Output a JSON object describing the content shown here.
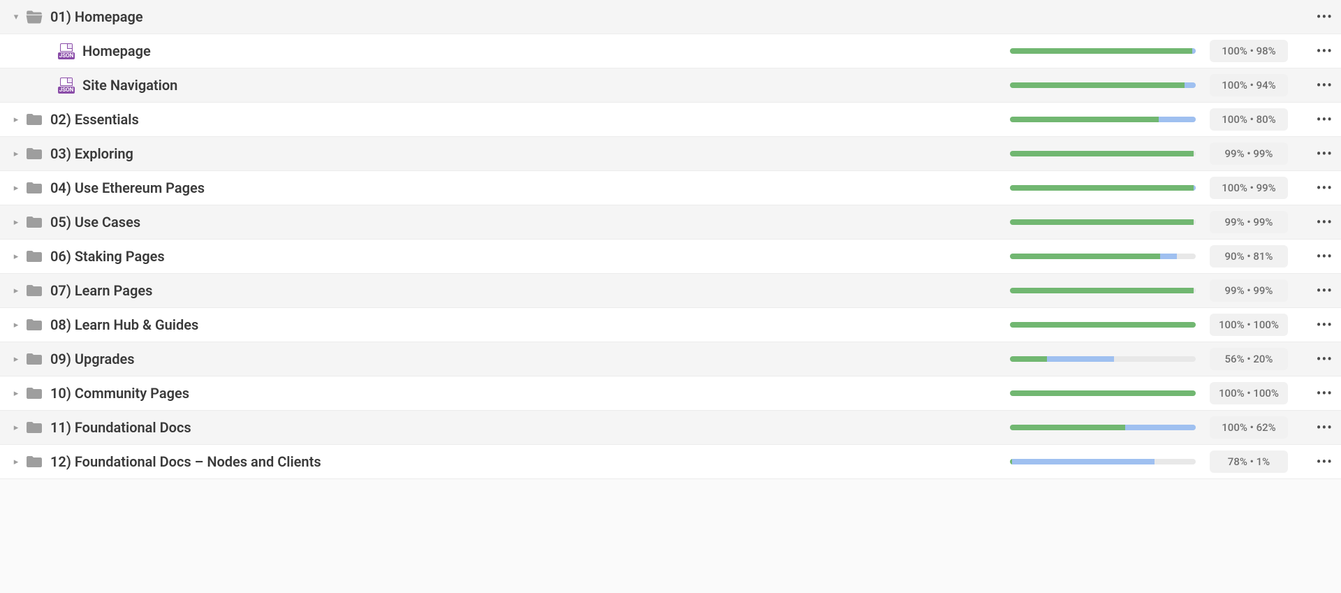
{
  "jsonLabel": "JSON",
  "rows": [
    {
      "level": 0,
      "type": "folder",
      "expanded": true,
      "name": "01) Homepage",
      "hasStats": false,
      "green": 0,
      "blue": 0,
      "pct1": "",
      "pct2": ""
    },
    {
      "level": 1,
      "type": "file",
      "expanded": false,
      "name": "Homepage",
      "hasStats": true,
      "green": 98,
      "blue": 2,
      "pct1": "100%",
      "pct2": "98%"
    },
    {
      "level": 1,
      "type": "file",
      "expanded": false,
      "name": "Site Navigation",
      "hasStats": true,
      "green": 94,
      "blue": 6,
      "pct1": "100%",
      "pct2": "94%"
    },
    {
      "level": 0,
      "type": "folder",
      "expanded": false,
      "name": "02) Essentials",
      "hasStats": true,
      "green": 80,
      "blue": 20,
      "pct1": "100%",
      "pct2": "80%"
    },
    {
      "level": 0,
      "type": "folder",
      "expanded": false,
      "name": "03) Exploring",
      "hasStats": true,
      "green": 99,
      "blue": 0,
      "pct1": "99%",
      "pct2": "99%"
    },
    {
      "level": 0,
      "type": "folder",
      "expanded": false,
      "name": "04) Use Ethereum Pages",
      "hasStats": true,
      "green": 99,
      "blue": 1,
      "pct1": "100%",
      "pct2": "99%"
    },
    {
      "level": 0,
      "type": "folder",
      "expanded": false,
      "name": "05) Use Cases",
      "hasStats": true,
      "green": 99,
      "blue": 0,
      "pct1": "99%",
      "pct2": "99%"
    },
    {
      "level": 0,
      "type": "folder",
      "expanded": false,
      "name": "06) Staking Pages",
      "hasStats": true,
      "green": 81,
      "blue": 9,
      "pct1": "90%",
      "pct2": "81%"
    },
    {
      "level": 0,
      "type": "folder",
      "expanded": false,
      "name": "07) Learn Pages",
      "hasStats": true,
      "green": 99,
      "blue": 0,
      "pct1": "99%",
      "pct2": "99%"
    },
    {
      "level": 0,
      "type": "folder",
      "expanded": false,
      "name": "08) Learn Hub & Guides",
      "hasStats": true,
      "green": 100,
      "blue": 0,
      "pct1": "100%",
      "pct2": "100%"
    },
    {
      "level": 0,
      "type": "folder",
      "expanded": false,
      "name": "09) Upgrades",
      "hasStats": true,
      "green": 20,
      "blue": 36,
      "pct1": "56%",
      "pct2": "20%"
    },
    {
      "level": 0,
      "type": "folder",
      "expanded": false,
      "name": "10) Community Pages",
      "hasStats": true,
      "green": 100,
      "blue": 0,
      "pct1": "100%",
      "pct2": "100%"
    },
    {
      "level": 0,
      "type": "folder",
      "expanded": false,
      "name": "11) Foundational Docs",
      "hasStats": true,
      "green": 62,
      "blue": 38,
      "pct1": "100%",
      "pct2": "62%"
    },
    {
      "level": 0,
      "type": "folder",
      "expanded": false,
      "name": "12) Foundational Docs – Nodes and Clients",
      "hasStats": true,
      "green": 1,
      "blue": 77,
      "pct1": "78%",
      "pct2": "1%"
    }
  ]
}
